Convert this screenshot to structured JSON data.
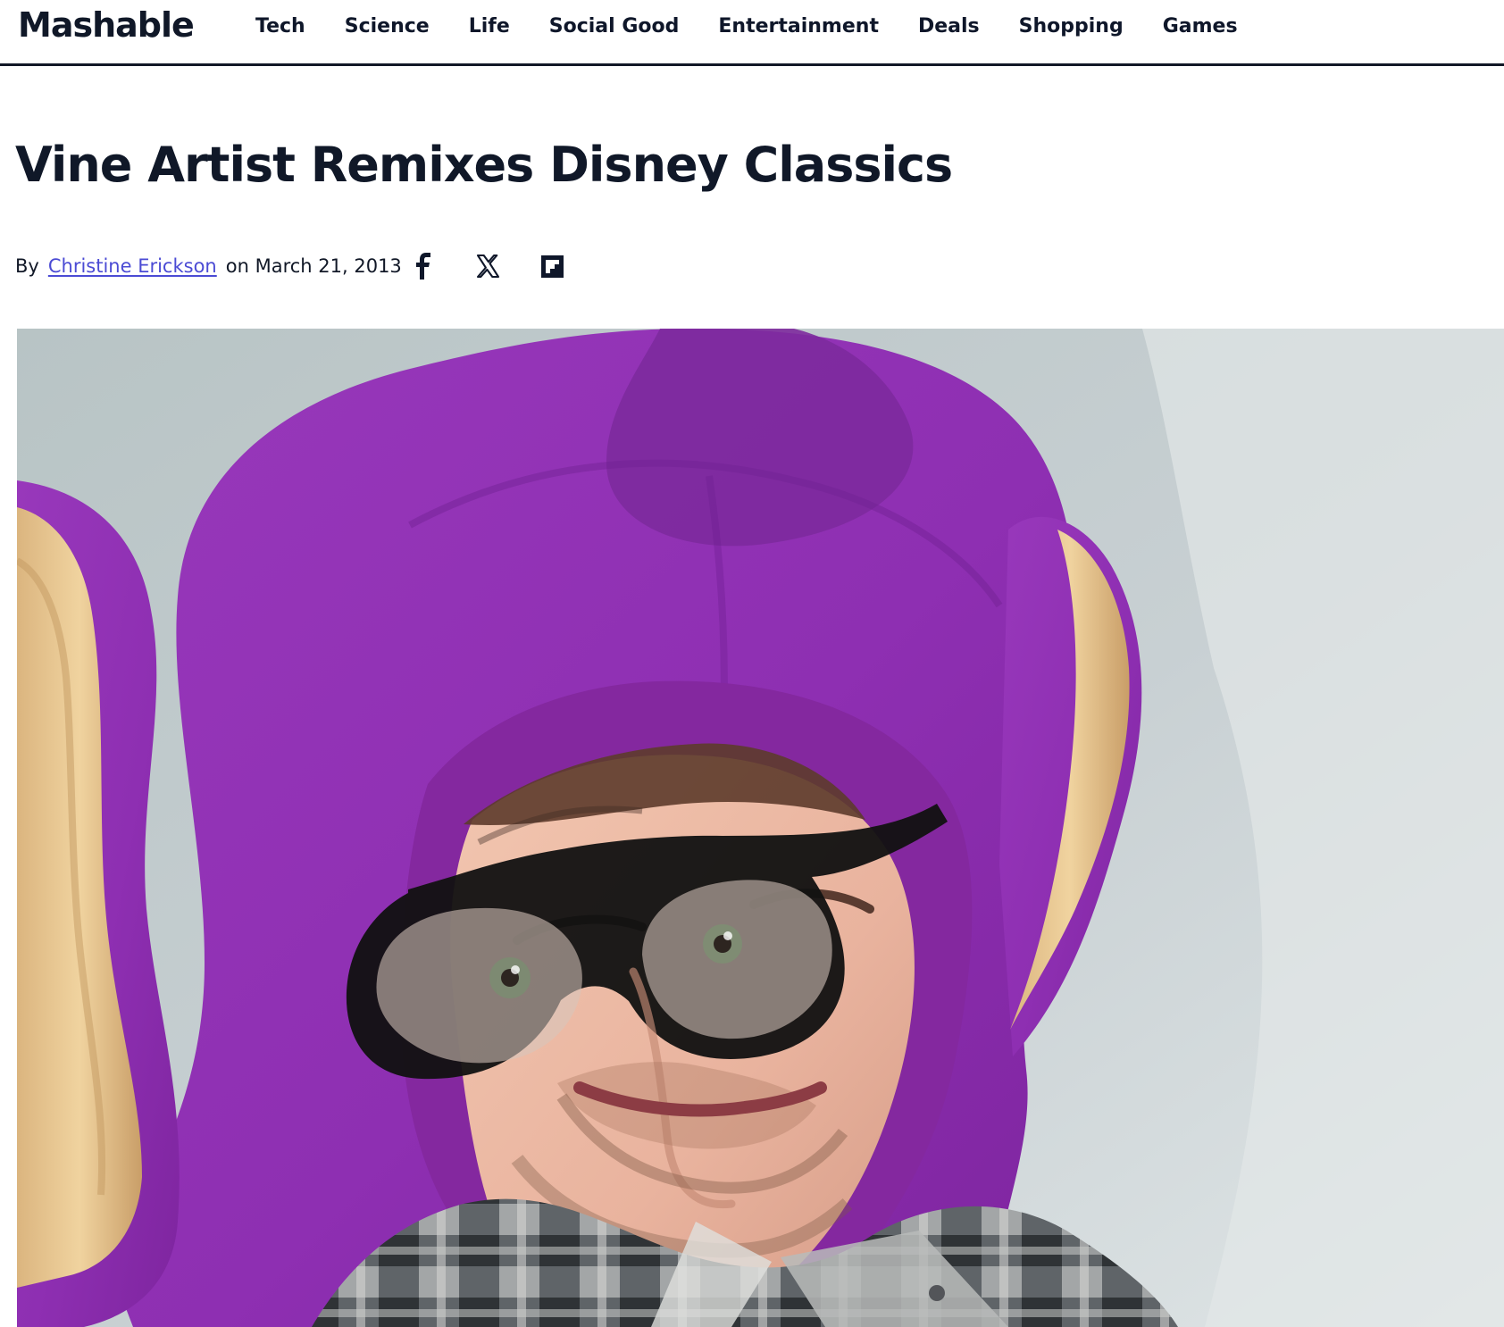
{
  "header": {
    "logo": "Mashable",
    "nav": [
      {
        "label": "Tech"
      },
      {
        "label": "Science"
      },
      {
        "label": "Life"
      },
      {
        "label": "Social Good"
      },
      {
        "label": "Entertainment"
      },
      {
        "label": "Deals"
      },
      {
        "label": "Shopping"
      },
      {
        "label": "Games"
      }
    ]
  },
  "article": {
    "title": "Vine Artist Remixes Disney Classics",
    "byline_prefix": "By",
    "author": "Christine Erickson",
    "date": "on March 21, 2013"
  },
  "share": {
    "icons": [
      "facebook-icon",
      "x-icon",
      "flipboard-icon"
    ]
  },
  "colors": {
    "text": "#0f172a",
    "author_link": "#4b4bd4",
    "header_border": "#111827",
    "hat_purple": "#8e33b3",
    "ear_inner": "#e7c58f"
  }
}
